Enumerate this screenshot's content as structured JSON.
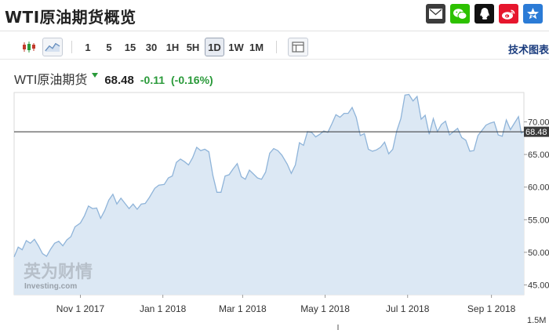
{
  "header": {
    "title": "WTI原油期货概览",
    "share_icons": [
      {
        "name": "email-icon",
        "color": "#3c3c3c"
      },
      {
        "name": "wechat-icon",
        "color": "#2dc100"
      },
      {
        "name": "qq-icon",
        "color": "#111111"
      },
      {
        "name": "weibo-icon",
        "color": "#e6162d"
      },
      {
        "name": "qzone-icon",
        "color": "#2b7bd6"
      }
    ]
  },
  "toolbar": {
    "chart_type_icons": [
      "candlestick-icon",
      "line-chart-icon"
    ],
    "intervals": [
      "1",
      "5",
      "15",
      "30",
      "1H",
      "5H",
      "1D",
      "1W",
      "1M"
    ],
    "active_interval": "1D",
    "layout_icon": "layout-icon",
    "tech_chart_label": "技术图表"
  },
  "quote": {
    "name": "WTI原油期货",
    "price": "68.48",
    "change": "-0.11",
    "change_pct": "(-0.16%)",
    "down_color": "#2a9a3a"
  },
  "watermark": {
    "brand_cn": "英为财情",
    "brand_en": "Investing.com"
  },
  "chart_data": {
    "type": "area",
    "x_tick_labels": [
      "Nov 1 2017",
      "Jan 1 2018",
      "Mar 1 2018",
      "May 1 2018",
      "Jul 1 2018",
      "Sep 1 2018"
    ],
    "y_tick_labels": [
      "70.00",
      "65.00",
      "60.00",
      "55.00",
      "50.00",
      "45.00"
    ],
    "volume_axis_label": "1.5M",
    "ylim": [
      43.5,
      74.5
    ],
    "current_price_line": 68.48,
    "current_price_label": "68.48",
    "line_color": "#8fb4d9",
    "fill_color": "#dce8f4",
    "x_start": "2017-09-13",
    "x_end": "2018-09-25",
    "points": [
      [
        "2017-09-13",
        49.3
      ],
      [
        "2017-09-16",
        50.8
      ],
      [
        "2017-09-19",
        50.4
      ],
      [
        "2017-09-22",
        51.8
      ],
      [
        "2017-09-25",
        51.4
      ],
      [
        "2017-09-28",
        52.0
      ],
      [
        "2017-10-01",
        51.0
      ],
      [
        "2017-10-04",
        49.8
      ],
      [
        "2017-10-07",
        49.4
      ],
      [
        "2017-10-10",
        50.5
      ],
      [
        "2017-10-13",
        51.4
      ],
      [
        "2017-10-16",
        51.7
      ],
      [
        "2017-10-19",
        51.0
      ],
      [
        "2017-10-22",
        51.9
      ],
      [
        "2017-10-25",
        52.4
      ],
      [
        "2017-10-28",
        53.9
      ],
      [
        "2017-11-01",
        54.5
      ],
      [
        "2017-11-04",
        55.6
      ],
      [
        "2017-11-07",
        57.1
      ],
      [
        "2017-11-10",
        56.7
      ],
      [
        "2017-11-13",
        56.8
      ],
      [
        "2017-11-16",
        55.2
      ],
      [
        "2017-11-19",
        56.4
      ],
      [
        "2017-11-22",
        58.0
      ],
      [
        "2017-11-25",
        58.9
      ],
      [
        "2017-11-28",
        57.4
      ],
      [
        "2017-12-01",
        58.3
      ],
      [
        "2017-12-04",
        57.5
      ],
      [
        "2017-12-07",
        56.7
      ],
      [
        "2017-12-10",
        57.4
      ],
      [
        "2017-12-13",
        56.6
      ],
      [
        "2017-12-16",
        57.4
      ],
      [
        "2017-12-19",
        57.5
      ],
      [
        "2017-12-22",
        58.4
      ],
      [
        "2017-12-26",
        59.8
      ],
      [
        "2017-12-29",
        60.3
      ],
      [
        "2018-01-02",
        60.4
      ],
      [
        "2018-01-05",
        61.4
      ],
      [
        "2018-01-08",
        61.7
      ],
      [
        "2018-01-11",
        63.8
      ],
      [
        "2018-01-14",
        64.3
      ],
      [
        "2018-01-17",
        63.9
      ],
      [
        "2018-01-20",
        63.4
      ],
      [
        "2018-01-23",
        64.5
      ],
      [
        "2018-01-26",
        66.1
      ],
      [
        "2018-01-29",
        65.6
      ],
      [
        "2018-02-01",
        65.8
      ],
      [
        "2018-02-04",
        65.4
      ],
      [
        "2018-02-07",
        61.8
      ],
      [
        "2018-02-10",
        59.2
      ],
      [
        "2018-02-13",
        59.2
      ],
      [
        "2018-02-16",
        61.7
      ],
      [
        "2018-02-19",
        61.9
      ],
      [
        "2018-02-22",
        62.8
      ],
      [
        "2018-02-25",
        63.6
      ],
      [
        "2018-02-28",
        61.6
      ],
      [
        "2018-03-03",
        61.2
      ],
      [
        "2018-03-06",
        62.6
      ],
      [
        "2018-03-09",
        62.0
      ],
      [
        "2018-03-12",
        61.4
      ],
      [
        "2018-03-15",
        61.2
      ],
      [
        "2018-03-18",
        62.3
      ],
      [
        "2018-03-21",
        65.2
      ],
      [
        "2018-03-24",
        65.9
      ],
      [
        "2018-03-27",
        65.6
      ],
      [
        "2018-03-30",
        64.9
      ],
      [
        "2018-04-03",
        63.5
      ],
      [
        "2018-04-06",
        62.1
      ],
      [
        "2018-04-09",
        63.4
      ],
      [
        "2018-04-12",
        66.8
      ],
      [
        "2018-04-15",
        66.4
      ],
      [
        "2018-04-18",
        68.5
      ],
      [
        "2018-04-21",
        68.4
      ],
      [
        "2018-04-24",
        67.7
      ],
      [
        "2018-04-27",
        68.1
      ],
      [
        "2018-04-30",
        68.6
      ],
      [
        "2018-05-03",
        68.4
      ],
      [
        "2018-05-06",
        69.7
      ],
      [
        "2018-05-09",
        71.1
      ],
      [
        "2018-05-12",
        70.7
      ],
      [
        "2018-05-15",
        71.3
      ],
      [
        "2018-05-18",
        71.3
      ],
      [
        "2018-05-21",
        72.2
      ],
      [
        "2018-05-24",
        70.7
      ],
      [
        "2018-05-27",
        67.9
      ],
      [
        "2018-05-30",
        68.2
      ],
      [
        "2018-06-02",
        65.8
      ],
      [
        "2018-06-05",
        65.5
      ],
      [
        "2018-06-08",
        65.7
      ],
      [
        "2018-06-11",
        66.1
      ],
      [
        "2018-06-14",
        66.9
      ],
      [
        "2018-06-17",
        65.1
      ],
      [
        "2018-06-20",
        65.8
      ],
      [
        "2018-06-23",
        68.6
      ],
      [
        "2018-06-26",
        70.5
      ],
      [
        "2018-06-29",
        74.1
      ],
      [
        "2018-07-02",
        74.2
      ],
      [
        "2018-07-05",
        73.2
      ],
      [
        "2018-07-08",
        73.9
      ],
      [
        "2018-07-11",
        70.4
      ],
      [
        "2018-07-14",
        71.0
      ],
      [
        "2018-07-17",
        68.1
      ],
      [
        "2018-07-20",
        70.5
      ],
      [
        "2018-07-23",
        68.5
      ],
      [
        "2018-07-26",
        69.6
      ],
      [
        "2018-07-29",
        70.1
      ],
      [
        "2018-08-01",
        68.0
      ],
      [
        "2018-08-04",
        68.5
      ],
      [
        "2018-08-07",
        69.0
      ],
      [
        "2018-08-10",
        67.6
      ],
      [
        "2018-08-13",
        67.2
      ],
      [
        "2018-08-16",
        65.5
      ],
      [
        "2018-08-19",
        65.6
      ],
      [
        "2018-08-22",
        67.9
      ],
      [
        "2018-08-25",
        68.7
      ],
      [
        "2018-08-28",
        69.5
      ],
      [
        "2018-08-31",
        69.8
      ],
      [
        "2018-09-03",
        70.0
      ],
      [
        "2018-09-06",
        68.0
      ],
      [
        "2018-09-09",
        67.8
      ],
      [
        "2018-09-12",
        70.3
      ],
      [
        "2018-09-15",
        68.8
      ],
      [
        "2018-09-18",
        69.8
      ],
      [
        "2018-09-21",
        70.8
      ],
      [
        "2018-09-23",
        68.3
      ],
      [
        "2018-09-25",
        68.5
      ]
    ]
  }
}
